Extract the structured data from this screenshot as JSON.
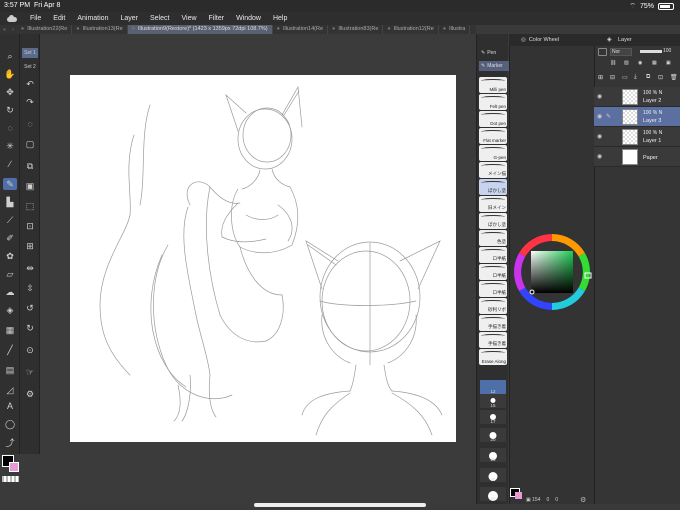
{
  "status_bar": {
    "time": "3:57 PM",
    "date": "Fri Apr 8",
    "battery": "75%"
  },
  "menu": [
    "File",
    "Edit",
    "Animation",
    "Layer",
    "Select",
    "View",
    "Filter",
    "Window",
    "Help"
  ],
  "tabs": [
    {
      "label": "Illustration22(Re",
      "active": false
    },
    {
      "label": "Illustration13(Re",
      "active": false
    },
    {
      "label": "Illustration9(Restore)* (1423 x 1359px 72dpi 108.7%)",
      "active": true
    },
    {
      "label": "Illustration14(Re",
      "active": false
    },
    {
      "label": "Illustration83(Re",
      "active": false
    },
    {
      "label": "Illustration12(Re",
      "active": false
    },
    {
      "label": "Illustra",
      "active": false
    }
  ],
  "sub_tool_sets": [
    "Set 1",
    "Set 2"
  ],
  "tools": [
    "magnifier-icon",
    "hand-icon",
    "move-icon",
    "rotate-icon",
    "lasso-icon",
    "magic-wand-icon",
    "eyedropper-icon",
    "pen-icon",
    "marker-icon",
    "brush-icon",
    "airbrush-icon",
    "decoration-icon",
    "eraser-icon",
    "blend-icon",
    "fill-icon",
    "gradient-icon",
    "line-icon",
    "frame-icon",
    "ruler-icon",
    "text-icon",
    "balloon-icon",
    "correct-line-icon"
  ],
  "brush_panel": {
    "tabs": [
      "Pen",
      "Marker"
    ],
    "brushes": [
      "Milli pen",
      "Felt pen",
      "Dot pen",
      "Flat marker",
      "G-pen",
      "メイン描",
      "ぼかし塗",
      "旧メイン",
      "ぼかし塗",
      "色塗",
      "ロ半紙",
      "ロ半紙",
      "ロ半紙",
      "砂利リボ",
      "",
      "手描き着",
      "手描き着",
      "Erase Along"
    ]
  },
  "brush_sizes": [
    "12",
    "15",
    "17",
    "20",
    "25",
    "30",
    "40"
  ],
  "color_panel": {
    "title": "Color Wheel"
  },
  "footer": {
    "pixel_readout": "154",
    "zero_a": "0",
    "zero_b": "0"
  },
  "layer_panel": {
    "title": "Layer",
    "blend_mode": "Nor",
    "opacity_value": "100",
    "layers": [
      {
        "opacity": "100 %",
        "mode": "N",
        "name": "Layer 2",
        "selected": false
      },
      {
        "opacity": "100 %",
        "mode": "N",
        "name": "Layer 3",
        "selected": true
      },
      {
        "opacity": "100 %",
        "mode": "N",
        "name": "Layer 1",
        "selected": false
      },
      {
        "opacity": "",
        "mode": "",
        "name": "Paper",
        "selected": false
      }
    ]
  },
  "colors": {
    "main": "#000000",
    "sub": "#e79ad6",
    "accent": "#4f6fa8"
  }
}
